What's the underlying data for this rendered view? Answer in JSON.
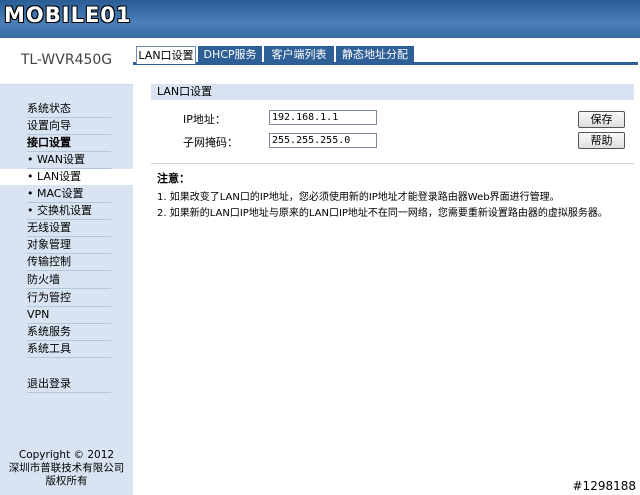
{
  "header": {
    "logo_text": "MOBILE01"
  },
  "sidebar": {
    "model": "TL-WVR450G",
    "items": [
      {
        "label": "系统状态",
        "bold": false,
        "sub": false
      },
      {
        "label": "设置向导",
        "bold": false,
        "sub": false
      },
      {
        "label": "接口设置",
        "bold": true,
        "sub": false
      },
      {
        "label": "• WAN设置",
        "bold": false,
        "sub": true
      },
      {
        "label": "• LAN设置",
        "bold": false,
        "sub": true,
        "active": true
      },
      {
        "label": "• MAC设置",
        "bold": false,
        "sub": true
      },
      {
        "label": "• 交换机设置",
        "bold": false,
        "sub": true
      },
      {
        "label": "无线设置",
        "bold": false,
        "sub": false
      },
      {
        "label": "对象管理",
        "bold": false,
        "sub": false
      },
      {
        "label": "传输控制",
        "bold": false,
        "sub": false
      },
      {
        "label": "防火墙",
        "bold": false,
        "sub": false
      },
      {
        "label": "行为管控",
        "bold": false,
        "sub": false
      },
      {
        "label": "VPN",
        "bold": false,
        "sub": false
      },
      {
        "label": "系统服务",
        "bold": false,
        "sub": false
      },
      {
        "label": "系统工具",
        "bold": false,
        "sub": false
      }
    ],
    "logout": "退出登录",
    "copyright": [
      "Copyright © 2012",
      "深圳市普联技术有限公司",
      "版权所有"
    ]
  },
  "tabs": [
    {
      "label": "LAN口设置",
      "active": true
    },
    {
      "label": "DHCP服务",
      "active": false
    },
    {
      "label": "客户端列表",
      "active": false
    },
    {
      "label": "静态地址分配",
      "active": false
    }
  ],
  "section": {
    "title": "LAN口设置",
    "ip_label": "IP地址：",
    "ip_value": "192.168.1.1",
    "mask_label": "子网掩码：",
    "mask_value": "255.255.255.0",
    "save_label": "保存",
    "help_label": "帮助"
  },
  "notes": {
    "title": "注意：",
    "lines": [
      "1. 如果改变了LAN口的IP地址，您必须使用新的IP地址才能登录路由器Web界面进行管理。",
      "2. 如果新的LAN口IP地址与原来的LAN口IP地址不在同一网络，您需要重新设置路由器的虚拟服务器。"
    ]
  },
  "watermark": "#1298188",
  "colors": {
    "accent": "#2f5f97",
    "menu_bg": "#d8e4f1"
  }
}
